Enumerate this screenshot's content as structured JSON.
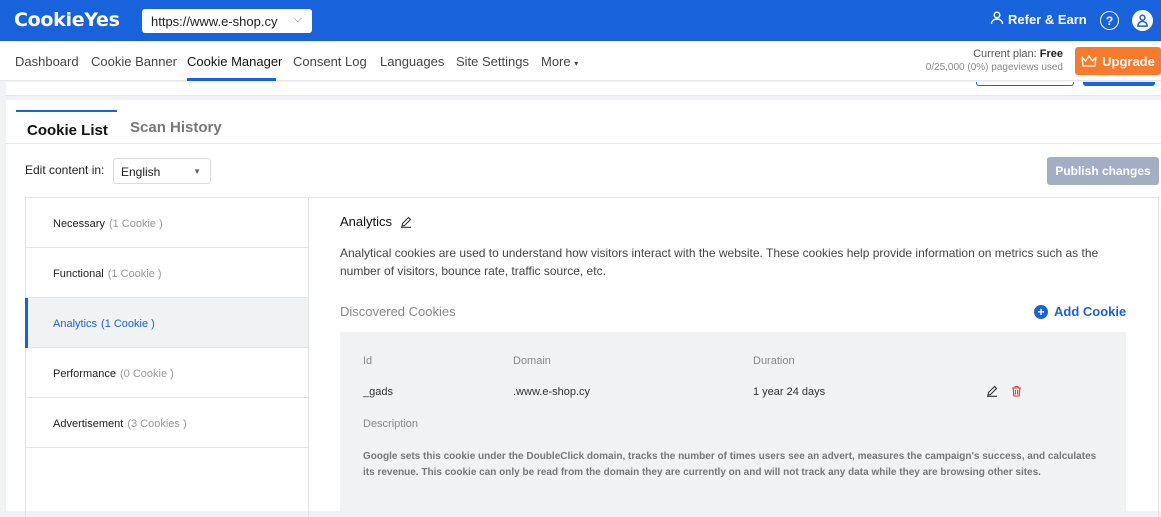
{
  "app": {
    "logo": "CookieYes",
    "site_url": "https://www.e-shop.cy"
  },
  "header": {
    "refer_label": "Refer & Earn",
    "help_icon": "help-icon",
    "avatar_icon": "user-icon"
  },
  "nav": {
    "items": [
      "Dashboard",
      "Cookie Banner",
      "Cookie Manager",
      "Consent Log",
      "Languages",
      "Site Settings",
      "More"
    ],
    "active": "Cookie Manager"
  },
  "plan": {
    "label": "Current plan:",
    "name": "Free",
    "usage": "0/25,000 (0%) pageviews used",
    "upgrade_label": "Upgrade"
  },
  "tabs": {
    "cookie_list": "Cookie List",
    "scan_history": "Scan History"
  },
  "edit": {
    "label": "Edit content in:",
    "language": "English"
  },
  "publish_label": "Publish changes",
  "categories": [
    {
      "name": "Necessary",
      "count": "(1 Cookie )"
    },
    {
      "name": "Functional",
      "count": "(1 Cookie )"
    },
    {
      "name": "Analytics",
      "count": "(1 Cookie )"
    },
    {
      "name": "Performance",
      "count": "(0 Cookie )"
    },
    {
      "name": "Advertisement",
      "count": "(3 Cookies )"
    }
  ],
  "selected": {
    "title": "Analytics",
    "description": "Analytical cookies are used to understand how visitors interact with the website. These cookies help provide information on metrics such as the number of visitors, bounce rate, traffic source, etc.",
    "discovered_label": "Discovered Cookies",
    "add_cookie_label": "Add Cookie",
    "table": {
      "headers": {
        "id": "Id",
        "domain": "Domain",
        "duration": "Duration",
        "description": "Description"
      },
      "cookie": {
        "id": "_gads",
        "domain": ".www.e-shop.cy",
        "duration": "1 year 24 days",
        "description": "Google sets this cookie under the DoubleClick domain, tracks the number of times users see an advert, measures the campaign's success, and calculates its revenue. This cookie can only be read from the domain they are currently on and will not track any data while they are browsing other sites."
      }
    }
  },
  "colors": {
    "brand": "#1863dc",
    "upgrade": "#f87b2b",
    "delete": "#e03c3c",
    "publish_disabled": "#a3aec4"
  }
}
